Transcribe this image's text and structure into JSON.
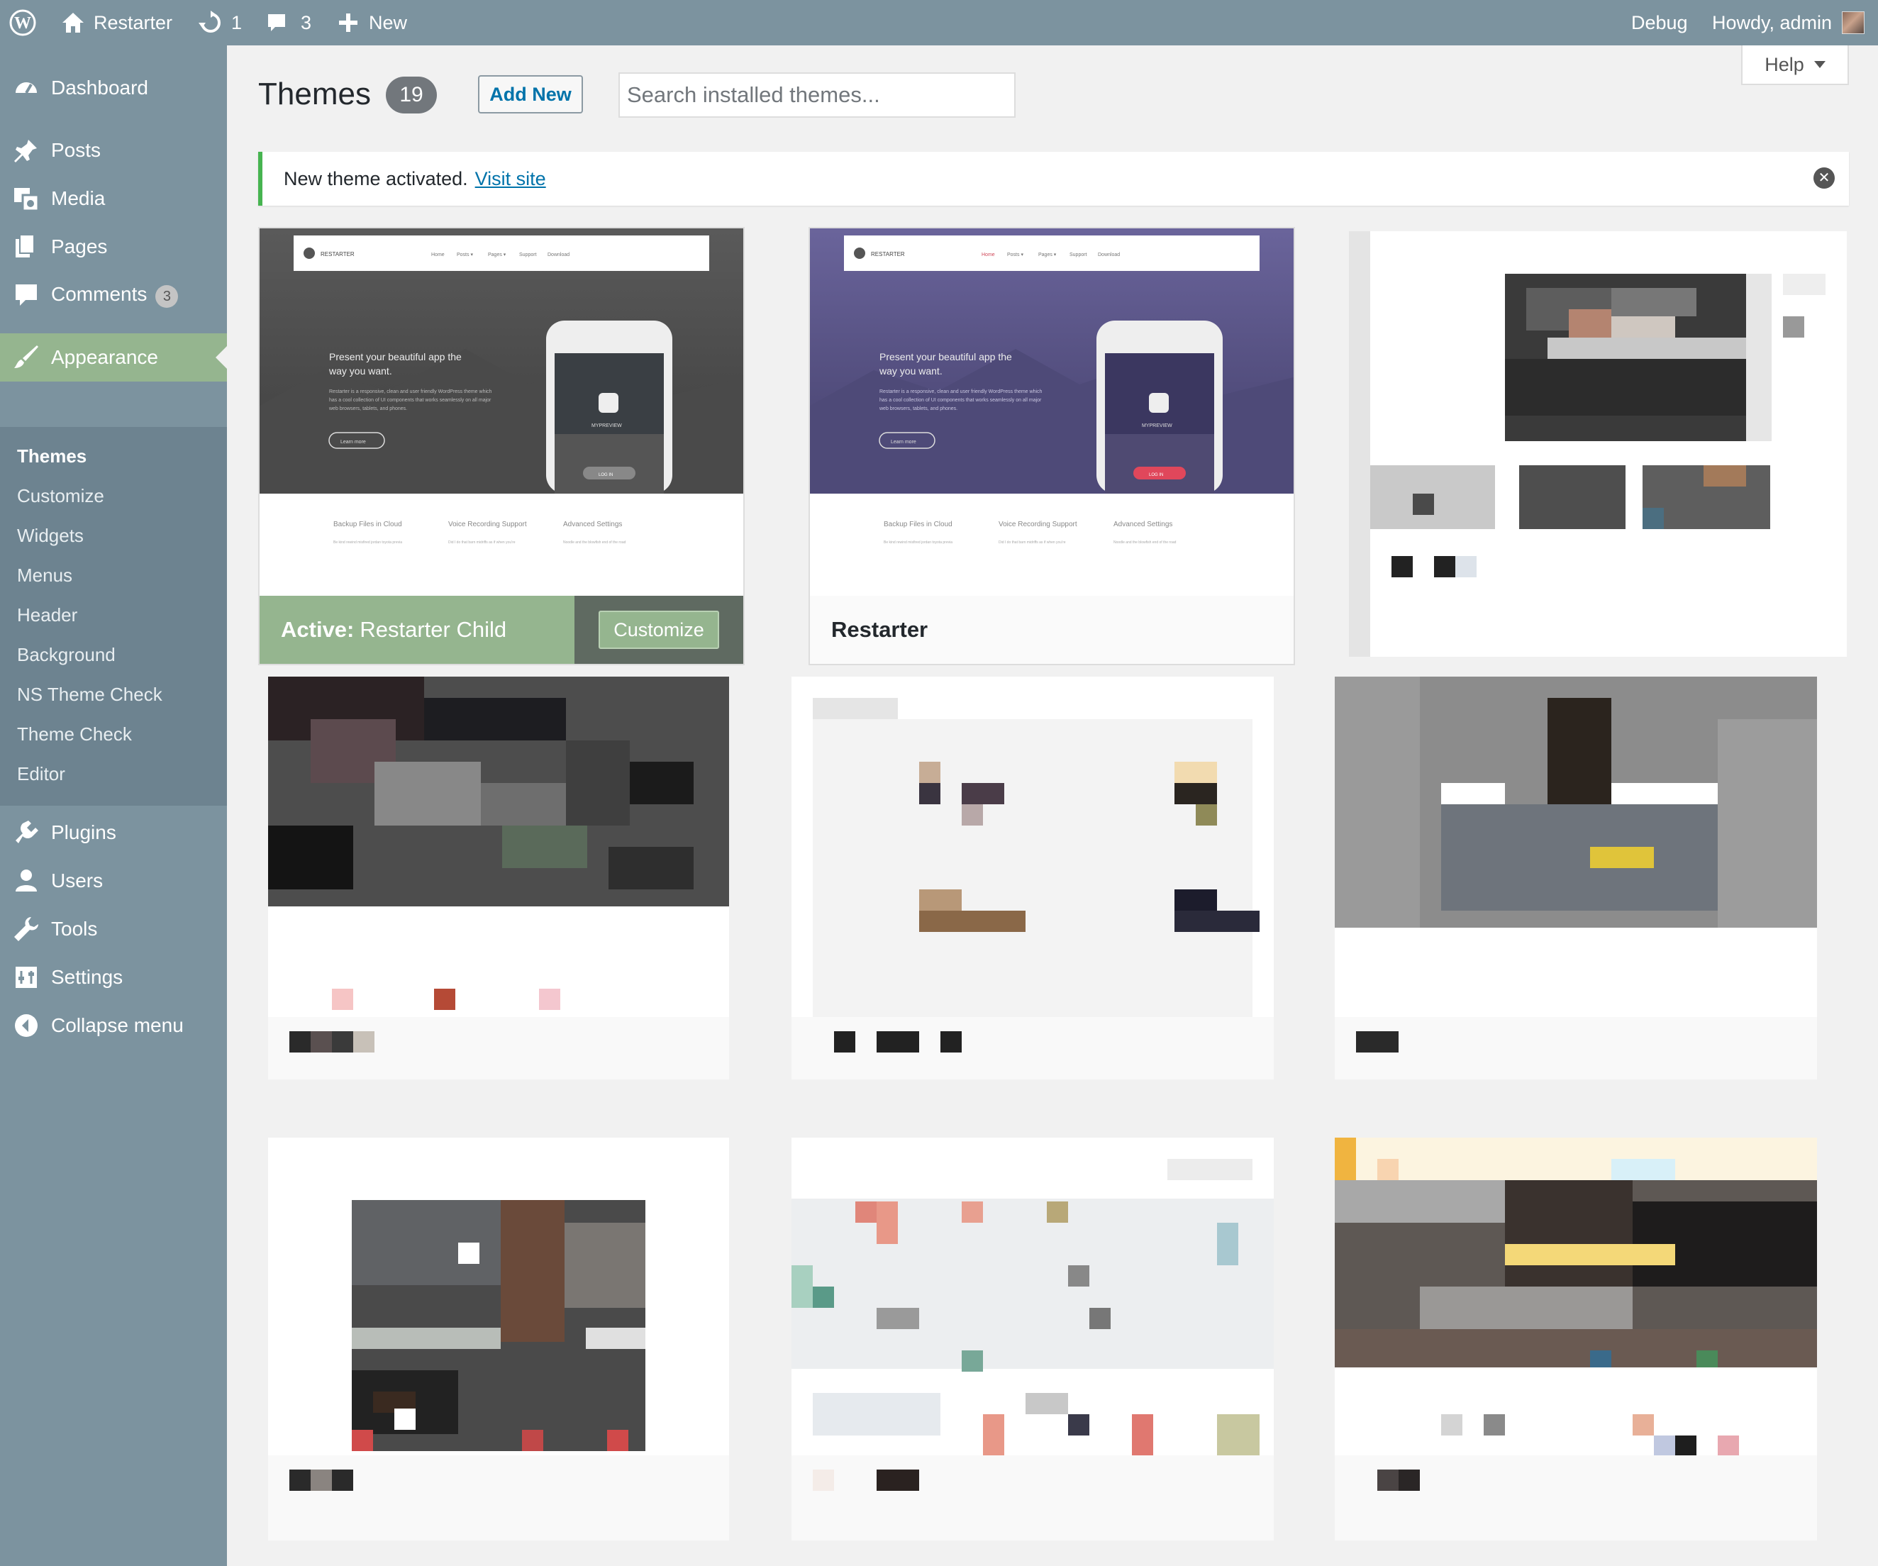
{
  "adminbar": {
    "site_name": "Restarter",
    "updates_count": "1",
    "comments_count": "3",
    "new_label": "New",
    "debug_label": "Debug",
    "howdy_label": "Howdy, admin"
  },
  "sidebar": {
    "items": [
      {
        "label": "Dashboard",
        "icon": "dashboard-icon"
      },
      {
        "label": "Posts",
        "icon": "pin-icon"
      },
      {
        "label": "Media",
        "icon": "media-icon"
      },
      {
        "label": "Pages",
        "icon": "pages-icon"
      },
      {
        "label": "Comments",
        "icon": "comment-icon",
        "badge": "3"
      },
      {
        "label": "Appearance",
        "icon": "brush-icon"
      },
      {
        "label": "Plugins",
        "icon": "plug-icon"
      },
      {
        "label": "Users",
        "icon": "user-icon"
      },
      {
        "label": "Tools",
        "icon": "wrench-icon"
      },
      {
        "label": "Settings",
        "icon": "settings-icon"
      },
      {
        "label": "Collapse menu",
        "icon": "collapse-icon"
      }
    ],
    "submenu": [
      "Themes",
      "Customize",
      "Widgets",
      "Menus",
      "Header",
      "Background",
      "NS Theme Check",
      "Theme Check",
      "Editor"
    ]
  },
  "page": {
    "title": "Themes",
    "count": "19",
    "add_new": "Add New",
    "search_placeholder": "Search installed themes...",
    "help": "Help"
  },
  "notice": {
    "text": "New theme activated.",
    "link": "Visit site"
  },
  "themes": [
    {
      "name": "Restarter Child",
      "active_prefix": "Active:",
      "customize": "Customize",
      "active": true
    },
    {
      "name": "Restarter",
      "active": false
    }
  ],
  "theme_preview": {
    "logo": "RESTARTER",
    "nav": [
      "Home",
      "Posts ▾",
      "Pages ▾",
      "Support",
      "Download"
    ],
    "headline_1": "Present your beautiful app the",
    "headline_2": "way you want.",
    "body_1": "Restarter is a responsive, clean and user friendly WordPress theme which",
    "body_2": "has a cool collection of UI components that works seamlessly on all major",
    "body_3": "web browsers, tablets, and phones.",
    "button": "Learn more",
    "phone_brand": "MYPREVIEW",
    "phone_button": "LOG IN",
    "features": [
      "Backup Files in Cloud",
      "Voice Recording Support",
      "Advanced Settings"
    ],
    "feature_text": [
      "Be kind rewind misfired jordan toyota previa",
      "Did I do that barn midriffs as if when you're",
      "Noodle and the blowfish end of the road"
    ]
  },
  "colors": {
    "admin_bg": "#7c939f",
    "submenu_bg": "#6d8390",
    "accent": "#95b58f",
    "link": "#0073aa",
    "notice_border": "#46b450"
  }
}
